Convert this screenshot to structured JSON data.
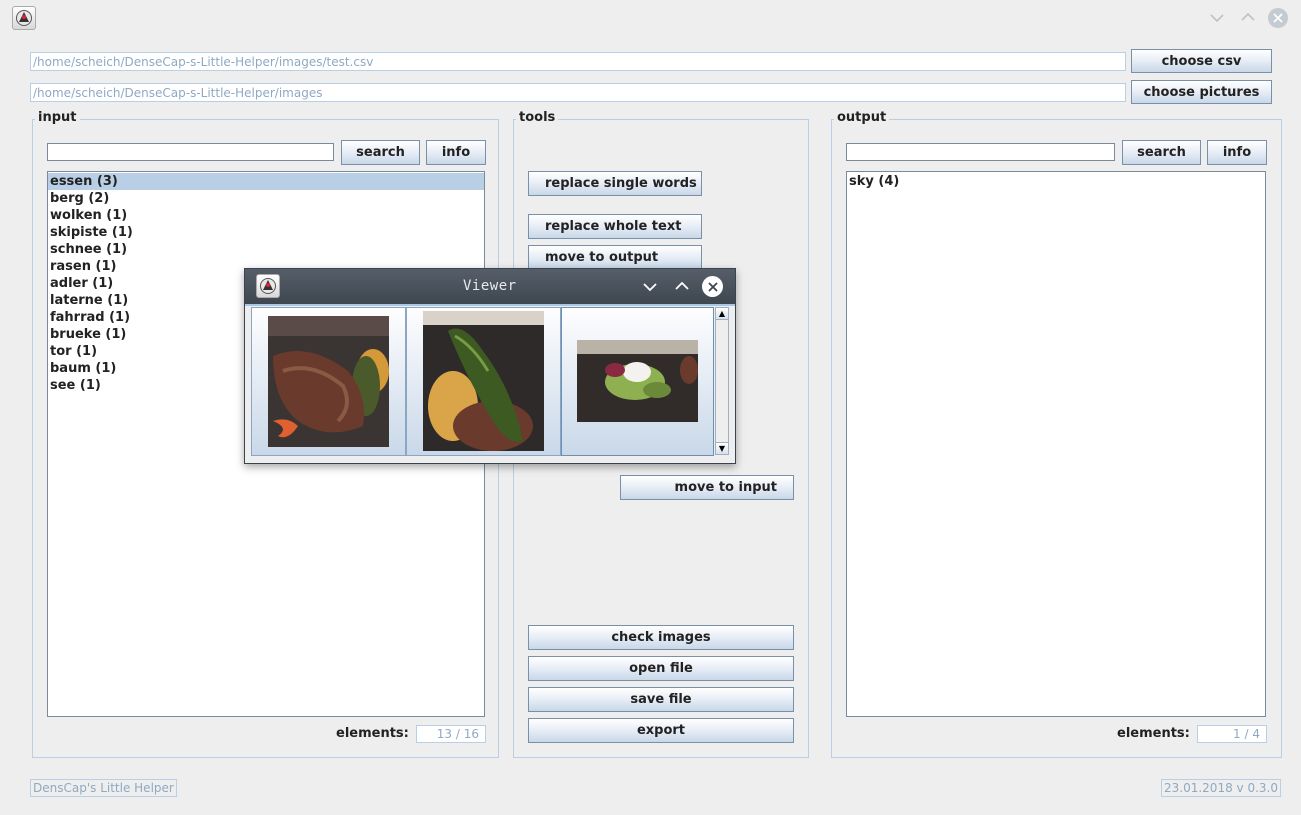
{
  "window": {
    "minimize_glyph": "⌵",
    "maximize_glyph": "⌃",
    "close_glyph": "✕"
  },
  "paths": {
    "csv_path": "/home/scheich/DenseCap-s-Little-Helper/images/test.csv",
    "pictures_path": "/home/scheich/DenseCap-s-Little-Helper/images",
    "choose_csv_label": "choose csv",
    "choose_pictures_label": "choose pictures"
  },
  "input": {
    "title": "input",
    "search_label": "search",
    "info_label": "info",
    "items": [
      "essen (3)",
      "berg (2)",
      "wolken (1)",
      "skipiste (1)",
      "schnee (1)",
      "rasen (1)",
      "adler (1)",
      "laterne (1)",
      "fahrrad (1)",
      "brueke (1)",
      "tor (1)",
      "baum (1)",
      "see (1)"
    ],
    "selected_index": 0,
    "elements_label": "elements:",
    "elements_count": "13 / 16"
  },
  "tools": {
    "title": "tools",
    "replace_single_words": "replace single words",
    "replace_whole_text": "replace whole text",
    "move_to_output": "move to output",
    "move_to_input": "move to input",
    "check_images": "check images",
    "open_file": "open file",
    "save_file": "save file",
    "export": "export"
  },
  "output": {
    "title": "output",
    "search_label": "search",
    "info_label": "info",
    "items": [
      "sky (4)"
    ],
    "elements_label": "elements:",
    "elements_count": "1 / 4"
  },
  "viewer": {
    "title": "Viewer",
    "thumbnails": [
      "steak-with-pepper",
      "grilled-pepper-on-potato",
      "salad-with-egg"
    ]
  },
  "footer": {
    "app_name": "DensCap's Little Helper",
    "version": "23.01.2018 v 0.3.0"
  },
  "colors": {
    "accent": "#b8cfe5",
    "field_text": "#8fa9c4",
    "viewer_bar": "#4a525d"
  }
}
